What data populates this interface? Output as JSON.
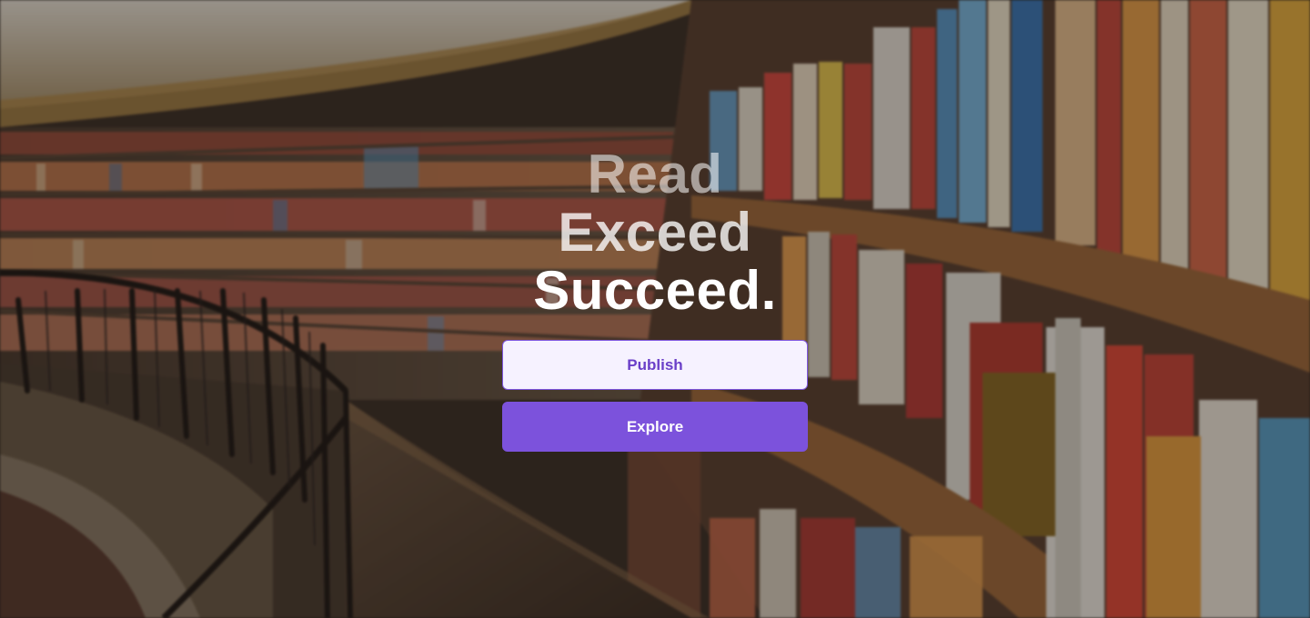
{
  "hero": {
    "headline": {
      "line1": "Read",
      "line2": "Exceed",
      "line3": "Succeed."
    },
    "publish_label": "Publish",
    "explore_label": "Explore",
    "background_image": "library-bookshelves"
  },
  "colors": {
    "accent": "#7c52dc",
    "publish_bg": "#f6f2ff",
    "publish_text": "#6a3fc8"
  }
}
